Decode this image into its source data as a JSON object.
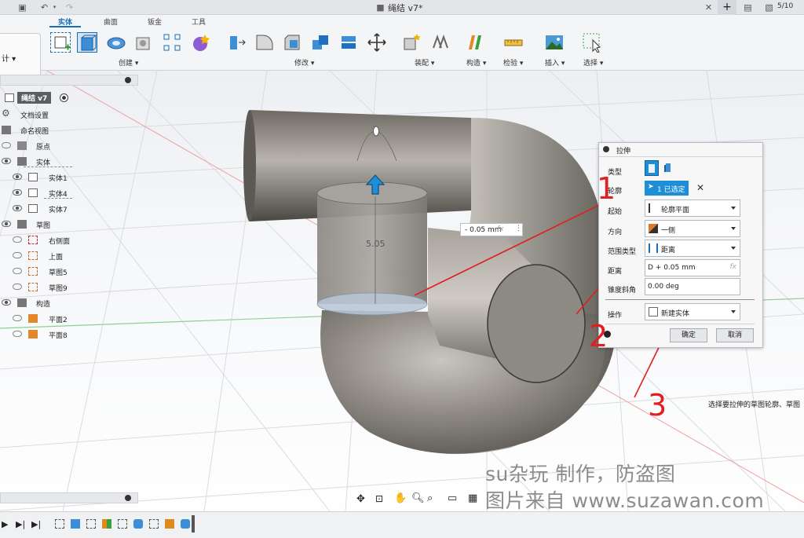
{
  "window": {
    "title": "绳结 v7*",
    "page_count": "5/10"
  },
  "ribbon": {
    "workspace_label": "计 ▾",
    "tabs": [
      "实体",
      "曲面",
      "钣金",
      "工具"
    ],
    "groups": [
      "创建 ▾",
      "修改 ▾",
      "装配 ▾",
      "构造 ▾",
      "检验 ▾",
      "插入 ▾",
      "选择 ▾"
    ]
  },
  "browser": {
    "root": "绳结 v7",
    "items": [
      {
        "label": "文档设置"
      },
      {
        "label": "命名视图"
      },
      {
        "label": "原点"
      },
      {
        "label": "实体"
      },
      {
        "label": "实体1"
      },
      {
        "label": "实体4"
      },
      {
        "label": "实体7"
      },
      {
        "label": "草图"
      },
      {
        "label": "右侧面"
      },
      {
        "label": "上面"
      },
      {
        "label": "草图5"
      },
      {
        "label": "草图9"
      },
      {
        "label": "构造"
      },
      {
        "label": "平面2"
      },
      {
        "label": "平面8"
      }
    ]
  },
  "viewport": {
    "dimension_label": "5.05",
    "distance_input": "- 0.05 mm",
    "fx": "fx"
  },
  "dialog": {
    "title": "拉伸",
    "rows": {
      "type_label": "类型",
      "profile_label": "轮廓",
      "profile_value": "1 已选定",
      "start_label": "起始",
      "start_value": "轮廓平面",
      "direction_label": "方向",
      "direction_value": "一侧",
      "extent_label": "范围类型",
      "extent_value": "距离",
      "distance_label": "距离",
      "distance_value": "D + 0.05 mm",
      "taper_label": "锥度斜角",
      "taper_value": "0.00 deg",
      "operation_label": "操作",
      "operation_value": "新建实体"
    },
    "ok": "确定",
    "cancel": "取消"
  },
  "annotations": {
    "n1": "1",
    "n2": "2",
    "n3": "3"
  },
  "tooltip": "选择要拉伸的草图轮廓、草图",
  "watermark": {
    "line1": "su杂玩 制作，防盗图",
    "line2": "图片来自 www.suzawan.com"
  },
  "colors": {
    "accent": "#1a6fb5",
    "annotation_red": "#e02020",
    "selected_btn": "#1e8fd6"
  }
}
